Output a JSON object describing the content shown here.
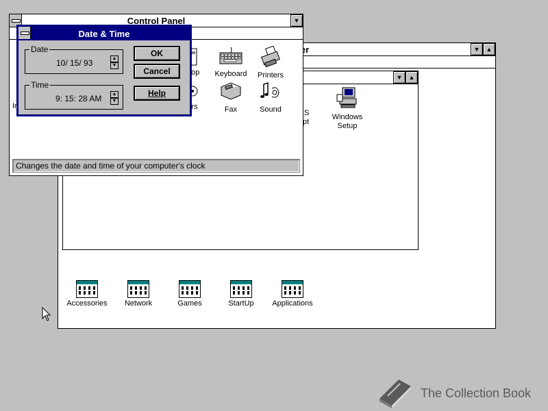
{
  "control_panel": {
    "title": "Control Panel",
    "status": "Changes the date and time of your computer's clock",
    "icons": [
      {
        "name": "keyboard",
        "label": "Keyboard"
      },
      {
        "name": "printers",
        "label": "Printers"
      },
      {
        "name": "fax",
        "label": "Fax"
      },
      {
        "name": "sound",
        "label": "Sound"
      }
    ],
    "partial_labels": {
      "desktop": "ktop",
      "drivers": "ers",
      "left": "Ir"
    }
  },
  "program_manager": {
    "title_fragment": "er",
    "groups": [
      {
        "label": "Accessories"
      },
      {
        "label": "Network"
      },
      {
        "label": "Games"
      },
      {
        "label": "StartUp"
      },
      {
        "label": "Applications"
      }
    ],
    "inner_group": {
      "windows_setup": "Windows\nSetup",
      "partial_label_1": "S",
      "partial_label_2": "pt"
    }
  },
  "dialog": {
    "title": "Date & Time",
    "date_legend": "Date",
    "date_value": "10/ 15/ 93",
    "time_legend": "Time",
    "time_value": "9: 15: 28 AM",
    "ok": "OK",
    "cancel": "Cancel",
    "help": "Help"
  },
  "watermark": {
    "text": "The Collection Book"
  },
  "colors": {
    "desktop": "#c0c0c0",
    "title_active": "#000080",
    "window": "#ffffff"
  }
}
